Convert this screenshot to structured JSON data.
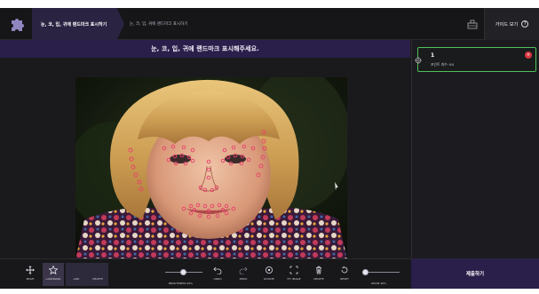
{
  "header": {
    "active_step": "눈, 코, 입, 귀에 랜드마크 표시하기",
    "breadcrumb": "눈, 코, 입, 귀에 랜드마크 표시하기",
    "guide_label": "가이드 보기",
    "guide_help": "?"
  },
  "main": {
    "instruction": "눈, 코, 입, 귀에 랜드마크 표시해주세요."
  },
  "side": {
    "card": {
      "number": "1",
      "subtitle": "포인트 개수: 64",
      "close": "×"
    }
  },
  "toolbar": {
    "move": "MOVE",
    "landmark": "LANDMARK",
    "add": "ADD",
    "delete_tool": "DELETE",
    "brightness": "BRIGHTNESS 50%",
    "brightness_level": 0.5,
    "undo": "UNDO",
    "redo": "REDO",
    "rotate": "ROTATE",
    "fit_image": "FIT IMAGE",
    "delete": "DELETE",
    "reset": "RESET",
    "zoom": "ZOOM 40%",
    "zoom_level": 0.4
  },
  "submit_label": "제출하기",
  "colors": {
    "accent": "#2a1f4a",
    "landmark": "#e8416a",
    "card_border": "#4fbf5a",
    "close": "#d9363e"
  }
}
